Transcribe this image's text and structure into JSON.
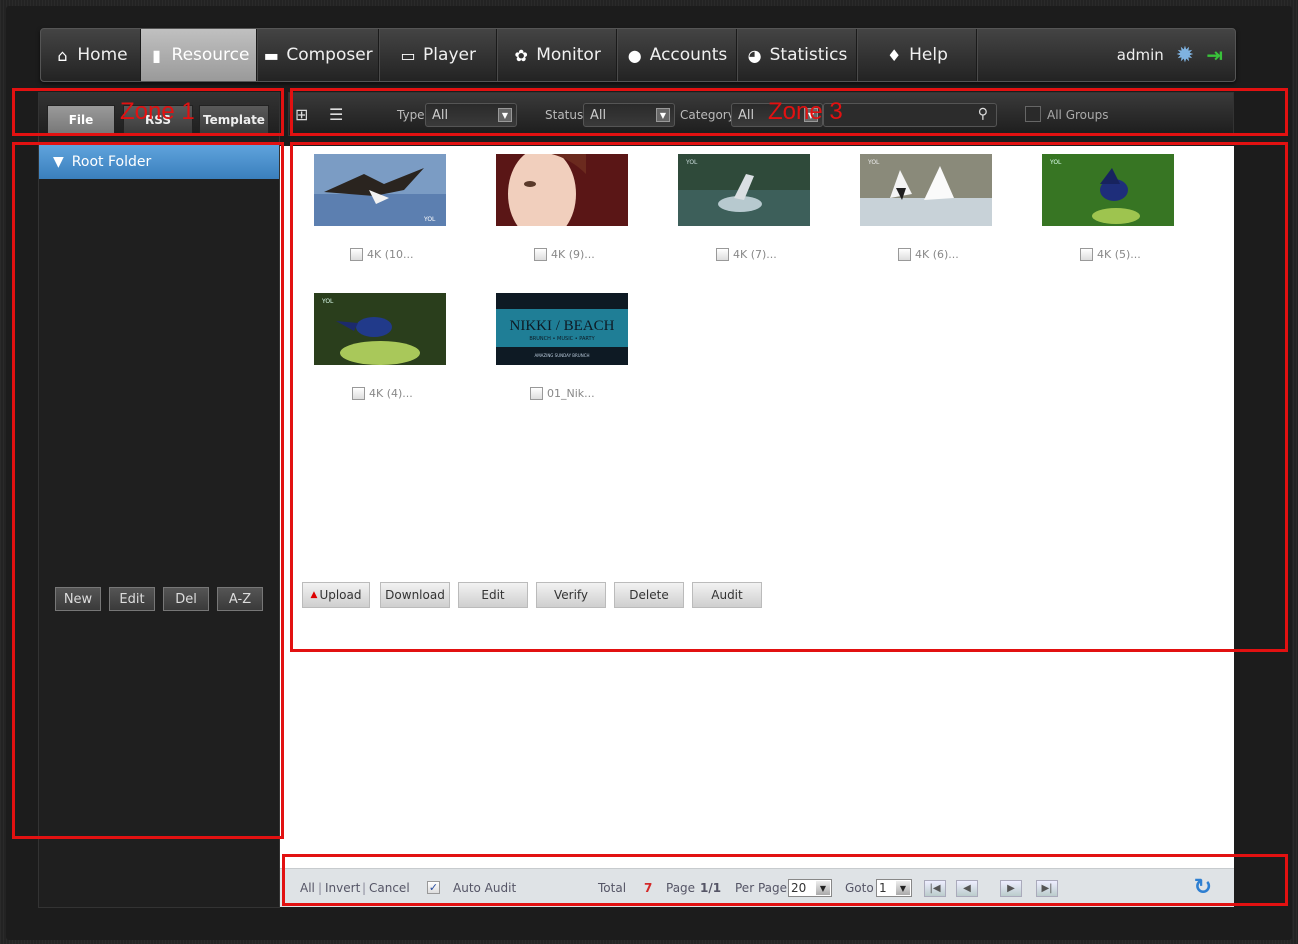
{
  "nav": {
    "items": [
      {
        "label": "Home",
        "icon": "home-icon",
        "glyph": "🏠"
      },
      {
        "label": "Resource",
        "icon": "document-icon",
        "glyph": "▮"
      },
      {
        "label": "Composer",
        "icon": "folder-icon",
        "glyph": "▬"
      },
      {
        "label": "Player",
        "icon": "monitor-icon",
        "glyph": "▭"
      },
      {
        "label": "Monitor",
        "icon": "gear-icon",
        "glyph": "✿"
      },
      {
        "label": "Accounts",
        "icon": "user-icon",
        "glyph": "●"
      },
      {
        "label": "Statistics",
        "icon": "pie-chart-icon",
        "glyph": "◕"
      },
      {
        "label": "Help",
        "icon": "lightbulb-icon",
        "glyph": "♦"
      }
    ],
    "active": "Resource",
    "user": "admin",
    "settings_glyph": "✹",
    "logout_glyph": "🏃"
  },
  "sidebar": {
    "tabs": [
      "File",
      "RSS",
      "Template"
    ],
    "active_tab": "File",
    "root_folder": "Root Folder",
    "expand_glyph": "▼",
    "buttons": [
      "New",
      "Edit",
      "Del",
      "A-Z"
    ]
  },
  "filters": {
    "type_label": "Type",
    "type_value": "All",
    "status_label": "Status",
    "status_value": "All",
    "category_label": "Category",
    "category_value": "All",
    "search_placeholder": "",
    "all_groups_label": "All Groups",
    "grid_glyph": "⊞",
    "list_glyph": "☰",
    "search_glyph": "⚲"
  },
  "media": [
    {
      "caption": "4K (10..."
    },
    {
      "caption": "4K (9)..."
    },
    {
      "caption": "4K (7)..."
    },
    {
      "caption": "4K (6)..."
    },
    {
      "caption": "4K (5)..."
    },
    {
      "caption": "4K (4)..."
    },
    {
      "caption": "01_Nik..."
    }
  ],
  "thumb_text": {
    "watermark": "YOL",
    "banner_title": "NIKKI / BEACH",
    "banner_sub1": "BRUNCH • MUSIC • PARTY",
    "banner_sub2": "AMAZING SUNDAY BRUNCH"
  },
  "actions": {
    "upload": "Upload",
    "download": "Download",
    "edit": "Edit",
    "verify": "Verify",
    "delete": "Delete",
    "audit": "Audit"
  },
  "status": {
    "all": "All",
    "invert": "Invert",
    "cancel": "Cancel",
    "sep": "|",
    "auto_audit": "Auto Audit",
    "total_label": "Total",
    "total_value": "7",
    "page_label": "Page",
    "page_value": "1/1",
    "per_page_label": "Per Page",
    "per_page_value": "20",
    "goto_label": "Goto",
    "goto_value": "1",
    "refresh_glyph": "↻"
  },
  "zones": {
    "zone1": "Zone 1",
    "zone3": "Zone 3"
  },
  "colors": {
    "zone_border": "#e21111",
    "folder_blue": "#4a90d0",
    "total_red": "#d42a2a",
    "refresh_blue": "#2e7fd1"
  }
}
